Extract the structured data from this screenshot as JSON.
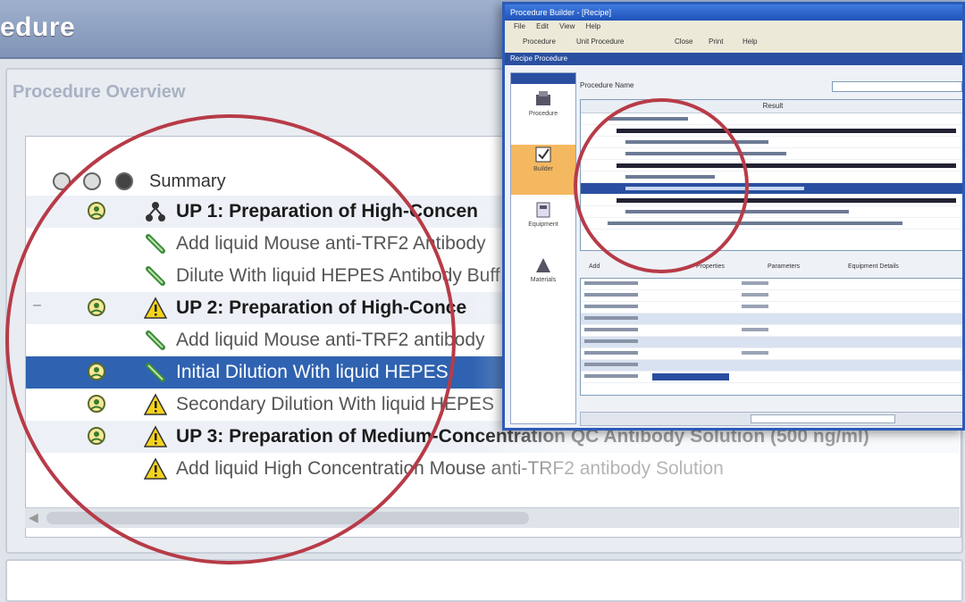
{
  "background": {
    "title": "edure",
    "overview_label": "Procedure Overview",
    "header": {
      "summary": "Summary"
    },
    "rows": [
      {
        "kind": "up",
        "text": "UP 1: Preparation of High-Concen",
        "icon": "unit-procedure-icon",
        "status": "user-icon"
      },
      {
        "kind": "step",
        "text": "Add liquid Mouse anti-TRF2 Antibody",
        "icon": "pipette-icon",
        "status": ""
      },
      {
        "kind": "step",
        "text": "Dilute With liquid HEPES Antibody Buff",
        "icon": "pipette-icon",
        "status": ""
      },
      {
        "kind": "up",
        "text": "UP 2: Preparation of High-Conce",
        "icon": "warning-icon",
        "status": "user-icon"
      },
      {
        "kind": "step",
        "text": "Add liquid Mouse anti-TRF2 antibody",
        "icon": "pipette-icon",
        "status": ""
      },
      {
        "kind": "sel",
        "text": "Initial Dilution With liquid HEPES",
        "icon": "pipette-icon",
        "status": "user-icon"
      },
      {
        "kind": "step",
        "text": "Secondary Dilution With liquid HEPES",
        "icon": "warning-icon",
        "status": "user-icon"
      },
      {
        "kind": "up",
        "text": "UP 3: Preparation of Medium-Concentration QC Antibody Solution (500 ng/ml)",
        "icon": "warning-icon",
        "status": "user-icon"
      },
      {
        "kind": "step",
        "text": "Add liquid High Concentration Mouse anti-TRF2 antibody Solution",
        "icon": "warning-icon",
        "status": ""
      }
    ]
  },
  "inset": {
    "title": "Procedure Builder - [Recipe]",
    "menu": [
      "File",
      "Edit",
      "View",
      "Help"
    ],
    "toolbar": [
      "Procedure",
      "Unit Procedure",
      "Close",
      "Print",
      "Help"
    ],
    "section_title": "Recipe Procedure",
    "nav": [
      "Procedure",
      "Builder",
      "Equipment",
      "Materials"
    ],
    "field_label": "Procedure Name",
    "field_value": "",
    "grid_header": "Result",
    "tabs": [
      "Add",
      "Properties",
      "Parameters",
      "Equipment Details"
    ]
  },
  "colors": {
    "highlight_circle": "#b73b48",
    "selection": "#2f62b0",
    "inset_border": "#2c5bb8"
  }
}
